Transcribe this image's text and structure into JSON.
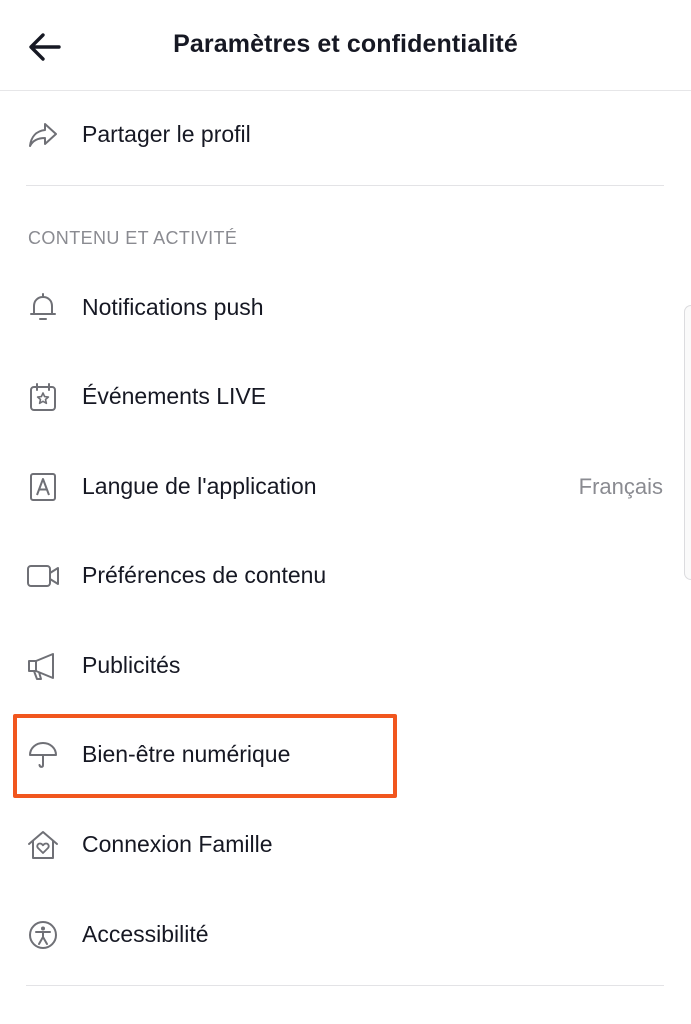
{
  "header": {
    "back_icon": "arrow-left-icon",
    "title": "Paramètres et confidentialité"
  },
  "share": {
    "icon": "share-arrow-icon",
    "label": "Partager le profil"
  },
  "content_section": {
    "heading": "CONTENU ET ACTIVITÉ",
    "items": [
      {
        "icon": "bell-icon",
        "label": "Notifications push",
        "value": ""
      },
      {
        "icon": "calendar-star-icon",
        "label": "Événements LIVE",
        "value": ""
      },
      {
        "icon": "letter-a-icon",
        "label": "Langue de l'application",
        "value": "Français"
      },
      {
        "icon": "video-camera-icon",
        "label": "Préférences de contenu",
        "value": ""
      },
      {
        "icon": "megaphone-icon",
        "label": "Publicités",
        "value": ""
      },
      {
        "icon": "umbrella-icon",
        "label": "Bien-être numérique",
        "value": ""
      },
      {
        "icon": "house-heart-icon",
        "label": "Connexion Famille",
        "value": ""
      },
      {
        "icon": "accessibility-icon",
        "label": "Accessibilité",
        "value": ""
      }
    ]
  },
  "colors": {
    "text": "#161823",
    "secondary_text": "#8a8b91",
    "highlight": "#f1561e",
    "divider": "#e3e3e6"
  }
}
